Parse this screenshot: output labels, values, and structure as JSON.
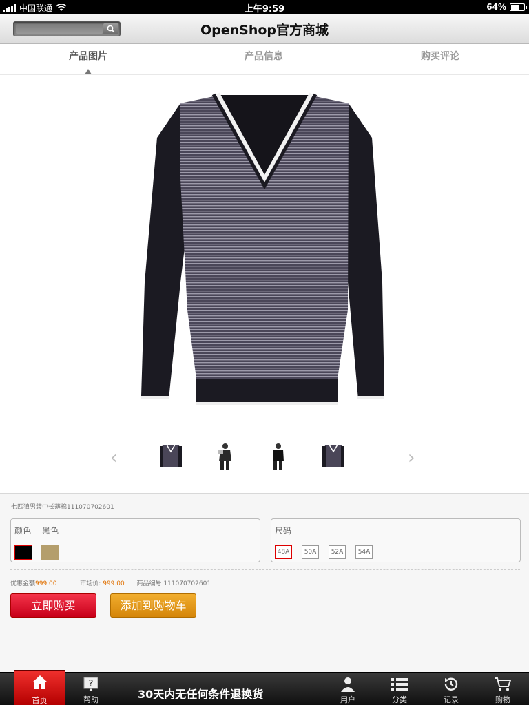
{
  "status_bar": {
    "carrier": "中国联通",
    "time": "上午9:59",
    "battery": "64%",
    "battery_level": 0.64
  },
  "header": {
    "title": "OpenShop官方商城",
    "search_placeholder": "",
    "search_icon": "search-icon"
  },
  "tabs": [
    {
      "label": "产品图片",
      "active": true
    },
    {
      "label": "产品信息",
      "active": false
    },
    {
      "label": "购买评论",
      "active": false
    }
  ],
  "gallery": {
    "prev_icon": "chevron-left-icon",
    "next_icon": "chevron-right-icon",
    "prev_glyph": "‹",
    "next_glyph": "›",
    "thumbnails": [
      "sweater-front",
      "model-side",
      "model-front",
      "sweater-front"
    ]
  },
  "product": {
    "name": "七匹狼男装中长薄棉111070702601",
    "color_label": "颜色",
    "color_value": "黑色",
    "colors": [
      "#000000",
      "#b49e6c"
    ],
    "size_label": "尺码",
    "sizes": [
      "48A",
      "50A",
      "52A",
      "54A"
    ],
    "selected_size": "48A",
    "discount_label": "优惠金额",
    "discount_price": "999.00",
    "market_label": "市场价:",
    "market_price": "999.00",
    "sku_label": "商品编号",
    "sku": "111070702601",
    "buy_label": "立即购买",
    "cart_label": "添加到购物车"
  },
  "tabbar": {
    "items": [
      {
        "label": "首页",
        "icon": "home-icon"
      },
      {
        "label": "帮助",
        "icon": "help-icon"
      },
      {
        "label": "用户",
        "icon": "user-icon"
      },
      {
        "label": "分类",
        "icon": "list-icon"
      },
      {
        "label": "记录",
        "icon": "history-icon"
      },
      {
        "label": "购物",
        "icon": "cart-icon"
      }
    ],
    "promo": "30天内无任何条件退换货"
  }
}
